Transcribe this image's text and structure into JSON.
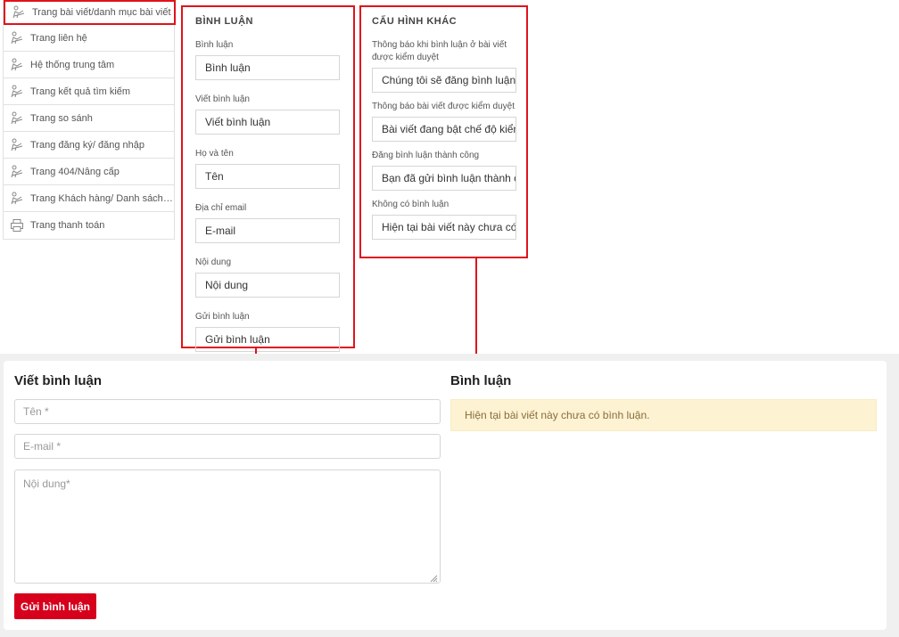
{
  "sidebar": {
    "items": [
      {
        "label": "Trang bài viết/danh mục bài viết",
        "icon": "reading-person-icon"
      },
      {
        "label": "Trang liên hệ",
        "icon": "reading-person-icon"
      },
      {
        "label": "Hệ thống trung tâm",
        "icon": "reading-person-icon"
      },
      {
        "label": "Trang kết quả tìm kiếm",
        "icon": "reading-person-icon"
      },
      {
        "label": "Trang so sánh",
        "icon": "reading-person-icon"
      },
      {
        "label": "Trang đăng ký/ đăng nhập",
        "icon": "reading-person-icon"
      },
      {
        "label": "Trang 404/Nâng cấp",
        "icon": "reading-person-icon"
      },
      {
        "label": "Trang Khách hàng/ Danh sách đ...",
        "icon": "reading-person-icon"
      },
      {
        "label": "Trang thanh toán",
        "icon": "printer-icon"
      }
    ]
  },
  "comment_config": {
    "title": "BÌNH LUẬN",
    "fields": [
      {
        "label": "Bình luận",
        "value": "Bình luận"
      },
      {
        "label": "Viết bình luận",
        "value": "Viết bình luận"
      },
      {
        "label": "Họ và tên",
        "value": "Tên"
      },
      {
        "label": "Địa chỉ email",
        "value": "E-mail"
      },
      {
        "label": "Nội dung",
        "value": "Nội dung"
      },
      {
        "label": "Gửi bình luận",
        "value": "Gửi bình luận"
      }
    ]
  },
  "other_config": {
    "title": "CẤU HÌNH KHÁC",
    "fields": [
      {
        "label": "Thông báo khi bình luận ở bài viết được kiểm duyệt",
        "value": "Chúng tôi sẽ đăng bình luận"
      },
      {
        "label": "Thông báo bài viết được kiểm duyệt",
        "value": "Bài viết đang bật chế độ kiểm"
      },
      {
        "label": "Đăng bình luận thành công",
        "value": "Bạn đã gửi bình luận thành công"
      },
      {
        "label": "Không có bình luận",
        "value": "Hiện tại bài viết này chưa có"
      }
    ]
  },
  "preview": {
    "write_title": "Viết bình luận",
    "name_placeholder": "Tên *",
    "email_placeholder": "E-mail *",
    "content_placeholder": "Nội dung*",
    "submit_label": "Gửi bình luận",
    "comments_title": "Bình luận",
    "no_comments_notice": "Hiện tại bài viết này chưa có bình luận."
  },
  "colors": {
    "highlight": "#e0131c",
    "button": "#d6001c",
    "notice_bg": "#fdf3d3",
    "notice_text": "#8a6d3b"
  }
}
